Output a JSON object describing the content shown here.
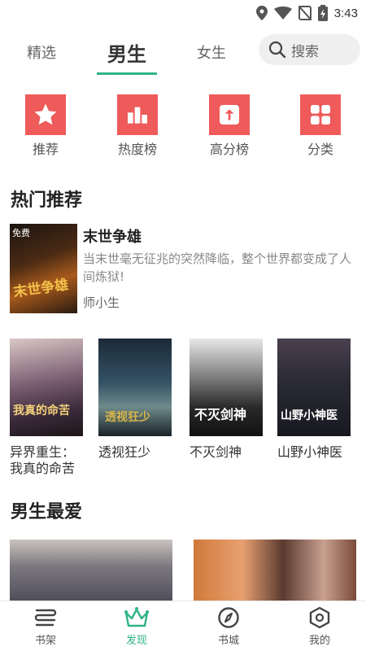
{
  "status_bar": {
    "time": "3:43",
    "icons": [
      "location-icon",
      "wifi-icon",
      "no-sim-icon",
      "battery-charging-icon"
    ]
  },
  "top_tabs": [
    {
      "label": "精选",
      "active": false
    },
    {
      "label": "男生",
      "active": true
    },
    {
      "label": "女生",
      "active": false
    }
  ],
  "search": {
    "placeholder": "搜索"
  },
  "categories": [
    {
      "label": "推荐",
      "icon": "star-icon"
    },
    {
      "label": "热度榜",
      "icon": "bar-chart-icon"
    },
    {
      "label": "高分榜",
      "icon": "arrow-up-icon"
    },
    {
      "label": "分类",
      "icon": "grid-icon"
    }
  ],
  "hot_section": {
    "title": "热门推荐",
    "featured": {
      "title": "末世争雄",
      "description": "当末世毫无征兆的突然降临，整个世界都变成了人间炼狱!",
      "author": "师小生",
      "cover_tag": "免费",
      "cover_text": "末世争雄"
    },
    "books": [
      {
        "title": "异界重生：我真的命苦啊",
        "cover_text": "我真的命苦"
      },
      {
        "title": "透视狂少",
        "cover_text": "透视狂少"
      },
      {
        "title": "不灭剑神",
        "cover_text": "不灭剑神"
      },
      {
        "title": "山野小神医",
        "cover_text": "山野小神医"
      }
    ]
  },
  "favorites_section": {
    "title": "男生最爱"
  },
  "bottom_nav": [
    {
      "label": "书架",
      "icon": "bookshelf-icon",
      "active": false
    },
    {
      "label": "发现",
      "icon": "crown-icon",
      "active": true
    },
    {
      "label": "书城",
      "icon": "compass-icon",
      "active": false
    },
    {
      "label": "我的",
      "icon": "profile-hexagon-icon",
      "active": false
    }
  ],
  "colors": {
    "accent": "#2fb28a",
    "category_red": "#ef5a5a"
  }
}
